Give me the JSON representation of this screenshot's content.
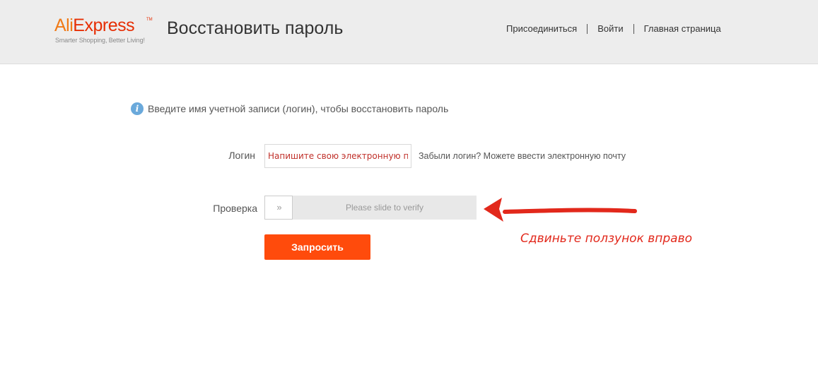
{
  "header": {
    "logo": {
      "brand_part1": "Ali",
      "brand_part2": "Express",
      "tm": "TM",
      "slogan": "Smarter Shopping, Better Living!"
    },
    "title": "Восстановить пароль",
    "nav": [
      {
        "label": "Присоединиться"
      },
      {
        "label": "Войти"
      },
      {
        "label": "Главная страница"
      }
    ]
  },
  "hint": {
    "icon": "info-icon",
    "text": "Введите имя учетной записи (логин), чтобы восстановить пароль"
  },
  "form": {
    "login_label": "Логин",
    "login_value": "",
    "login_placeholder": "Напишите свою электронную почту",
    "login_help": "Забыли логин? Можете ввести электронную почту",
    "verify_label": "Проверка",
    "slider_handle_icon": "double-chevron-right-icon",
    "slider_handle_glyph": "»",
    "slider_text": "Please slide to verify",
    "slider_progress": 0,
    "submit_label": "Запросить"
  },
  "annotation": {
    "text": "Сдвиньте ползунок вправо",
    "color": "#e2281b"
  },
  "colors": {
    "header_bg": "#ededed",
    "brand_orange": "#f07a17",
    "brand_red": "#e62e04",
    "button": "#ff4b0c",
    "info_icon": "#6aa9db"
  }
}
